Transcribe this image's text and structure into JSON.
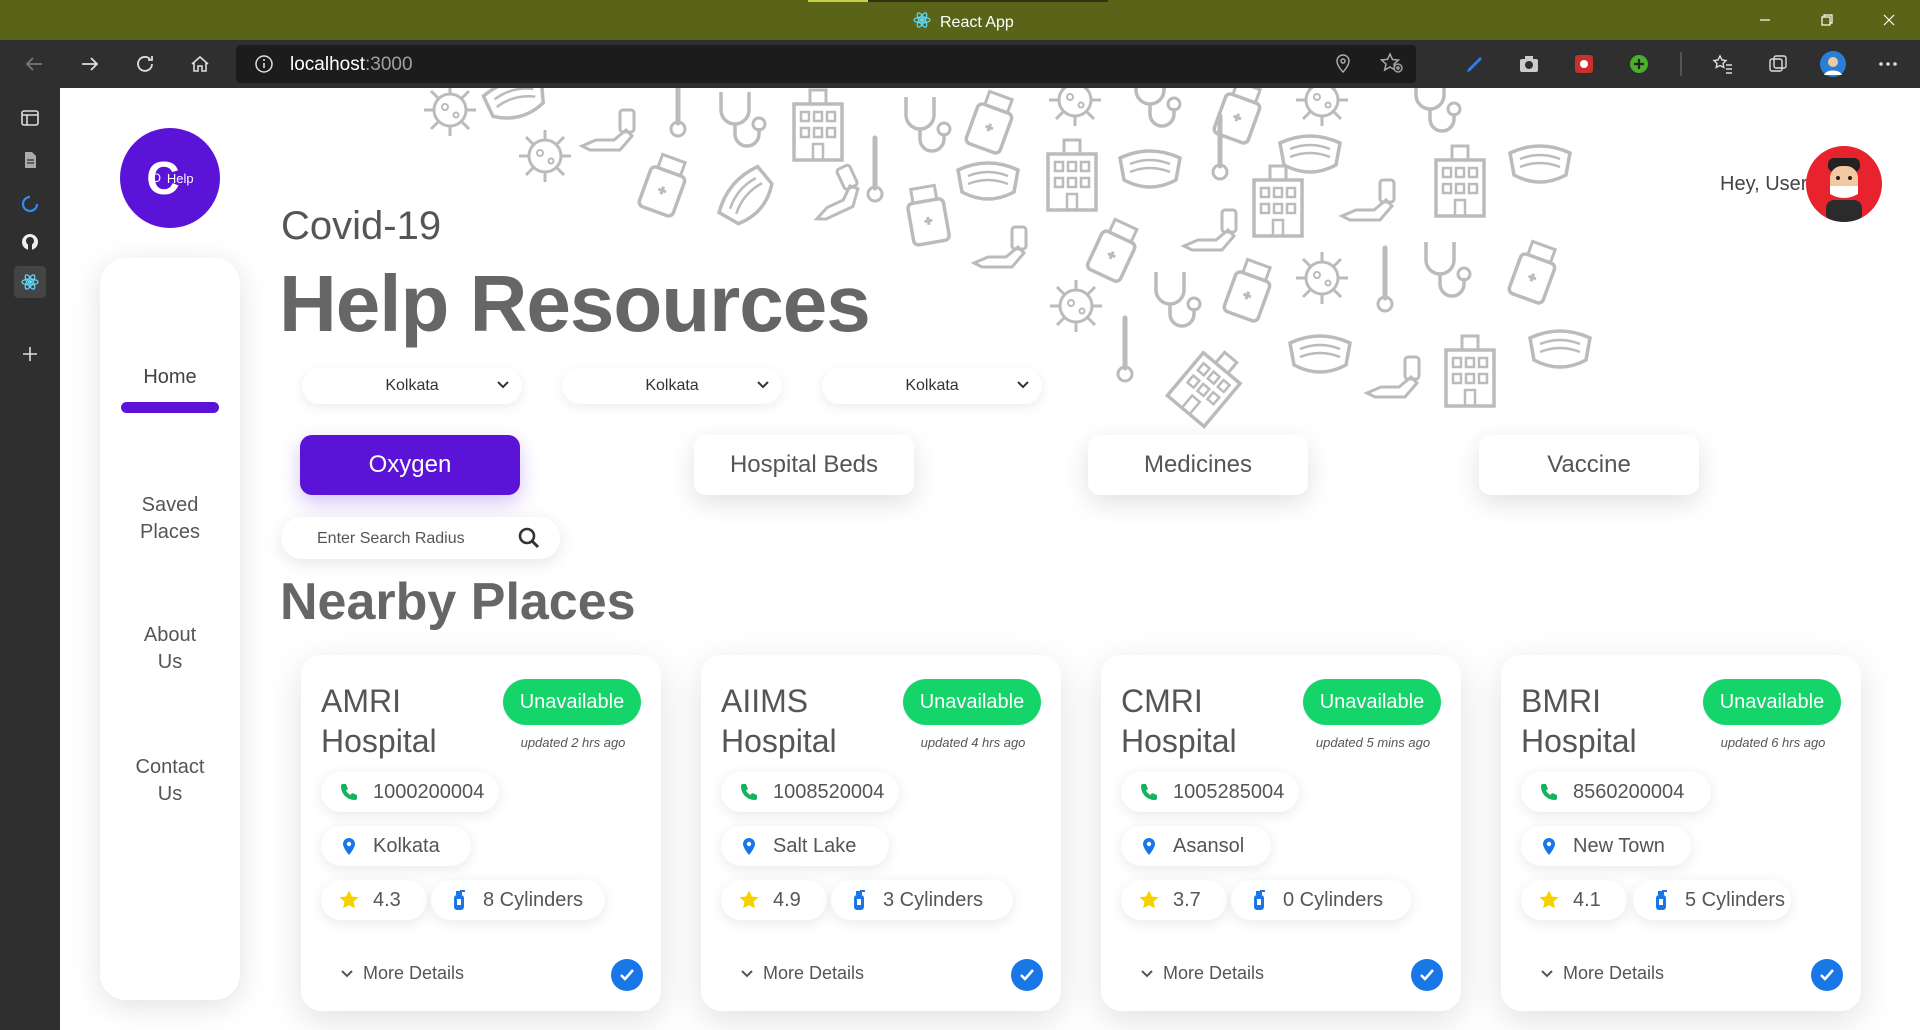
{
  "window": {
    "title": "React App"
  },
  "browser": {
    "url_host": "localhost",
    "url_port": ":3000"
  },
  "brand": {
    "logo_letter": "C",
    "logo_o": "O",
    "logo_help": "Help"
  },
  "nav": [
    {
      "label": "Home",
      "active": true
    },
    {
      "label": "Saved\nPlaces"
    },
    {
      "label": "About\nUs"
    },
    {
      "label": "Contact\nUs"
    }
  ],
  "header": {
    "eyebrow": "Covid-19",
    "title": "Help Resources"
  },
  "user": {
    "greeting": "Hey, User"
  },
  "filters": [
    "Kolkata",
    "Kolkata",
    "Kolkata"
  ],
  "categories": [
    {
      "label": "Oxygen",
      "active": true
    },
    {
      "label": "Hospital Beds"
    },
    {
      "label": "Medicines"
    },
    {
      "label": "Vaccine"
    }
  ],
  "search": {
    "placeholder": "Enter Search Radius"
  },
  "section_title": "Nearby Places",
  "colors": {
    "accent": "#5b13d8",
    "status": "#15d46a",
    "check": "#1976e6",
    "titlebar": "#5a6418"
  },
  "places": [
    {
      "name": "AMRI Hospital",
      "status": "Unavailable",
      "updated": "updated 2 hrs ago",
      "phone": "1000200004",
      "location": "Kolkata",
      "rating": "4.3",
      "cylinders": "8 Cylinders",
      "more": "More Details"
    },
    {
      "name": "AIIMS Hospital",
      "status": "Unavailable",
      "updated": "updated 4 hrs ago",
      "phone": "1008520004",
      "location": "Salt Lake",
      "rating": "4.9",
      "cylinders": "3 Cylinders",
      "more": "More Details"
    },
    {
      "name": "CMRI Hospital",
      "status": "Unavailable",
      "updated": "updated 5 mins ago",
      "phone": "1005285004",
      "location": "Asansol",
      "rating": "3.7",
      "cylinders": "0 Cylinders",
      "more": "More Details"
    },
    {
      "name": "BMRI Hospital",
      "status": "Unavailable",
      "updated": "updated 6 hrs ago",
      "phone": "8560200004",
      "location": "New Town",
      "rating": "4.1",
      "cylinders": "5 Cylinders",
      "more": "More Details"
    }
  ]
}
